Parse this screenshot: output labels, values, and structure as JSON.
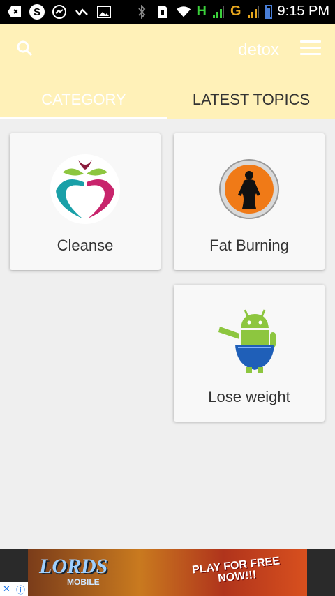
{
  "status_bar": {
    "left_icons": [
      "back-icon",
      "skype-icon",
      "messenger-icon",
      "check-icon",
      "image-icon"
    ],
    "right_icons": [
      "bluetooth-icon",
      "sim-icon",
      "wifi-icon"
    ],
    "signal1": "H",
    "signal2": "G",
    "time": "9:15 PM"
  },
  "app_bar": {
    "title": "detox",
    "search_icon": "search-icon",
    "menu_icon": "hamburger-menu-icon",
    "background": "#fff1b8"
  },
  "tabs": [
    {
      "label": "CATEGORY",
      "active": true
    },
    {
      "label": "LATEST TOPICS",
      "active": false
    }
  ],
  "categories": [
    {
      "label": "Cleanse",
      "icon": "apple-heart-icon"
    },
    {
      "label": "Fat Burning",
      "icon": "body-silhouette-icon"
    },
    {
      "label": "Lose weight",
      "icon": "android-scale-icon"
    }
  ],
  "ad": {
    "logo": "LORDS",
    "logo_sub": "MOBILE",
    "cta": "PLAY FOR FREE NOW!!!",
    "info_icons": [
      "close-x-icon",
      "info-icon"
    ]
  }
}
